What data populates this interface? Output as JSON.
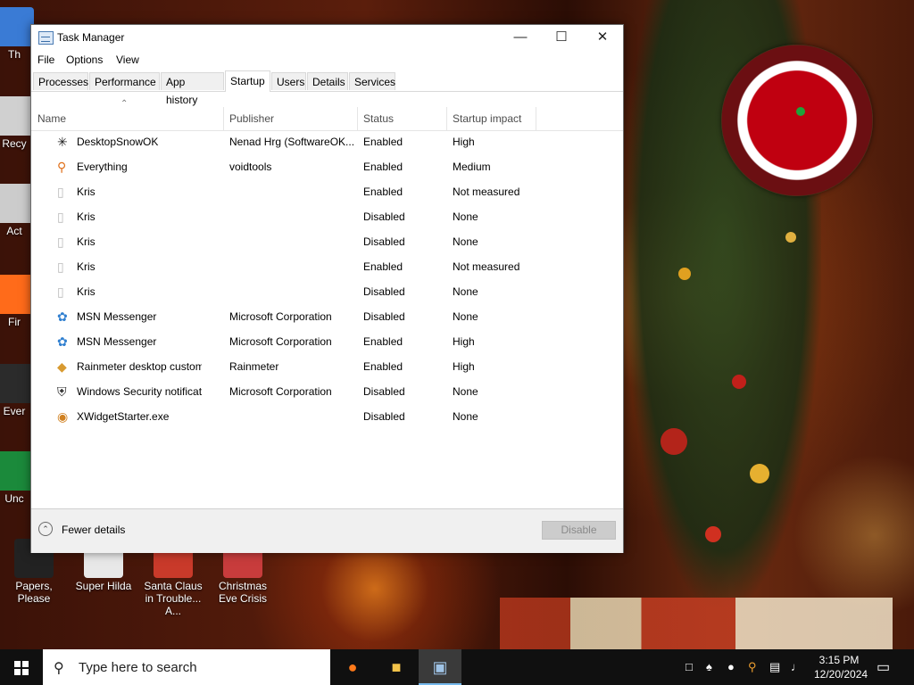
{
  "desktop": {
    "icons": [
      {
        "label": "Th",
        "color": "#3a7bd5"
      },
      {
        "label": "Recy",
        "color": "#d0d0d0"
      },
      {
        "label": "Act",
        "color": "#cccccc"
      },
      {
        "label": "Fir",
        "color": "#ff6b1a"
      },
      {
        "label": "Ever",
        "color": "#2b2b2b"
      },
      {
        "label": "Unc",
        "color": "#1b8a3b"
      },
      {
        "label": "Papers, Please",
        "color": "#222222"
      },
      {
        "label": "Super Hilda",
        "color": "#e8e8e8"
      },
      {
        "label": "Santa Claus in Trouble... A...",
        "color": "#c93a2a"
      },
      {
        "label": "Christmas Eve Crisis",
        "color": "#c83c3c"
      }
    ]
  },
  "window": {
    "title": "Task Manager",
    "controls": {
      "minimize": "—",
      "maximize": "☐",
      "close": "✕"
    },
    "menu": [
      "File",
      "Options",
      "View"
    ],
    "tabs": [
      "Processes",
      "Performance",
      "App history",
      "Startup",
      "Users",
      "Details",
      "Services"
    ],
    "active_tab": "Startup",
    "columns": {
      "name": "Name",
      "publisher": "Publisher",
      "status": "Status",
      "impact": "Startup impact"
    },
    "rows": [
      {
        "name": "DesktopSnowOK",
        "publisher": "Nenad Hrg (SoftwareOK...",
        "status": "Enabled",
        "impact": "High",
        "icon": "snowflake-icon"
      },
      {
        "name": "Everything",
        "publisher": "voidtools",
        "status": "Enabled",
        "impact": "Medium",
        "icon": "magnifier-icon"
      },
      {
        "name": "Kris",
        "publisher": "",
        "status": "Enabled",
        "impact": "Not measured",
        "icon": "blank-file-icon"
      },
      {
        "name": "Kris",
        "publisher": "",
        "status": "Disabled",
        "impact": "None",
        "icon": "blank-file-icon"
      },
      {
        "name": "Kris",
        "publisher": "",
        "status": "Disabled",
        "impact": "None",
        "icon": "blank-file-icon"
      },
      {
        "name": "Kris",
        "publisher": "",
        "status": "Enabled",
        "impact": "Not measured",
        "icon": "blank-file-icon"
      },
      {
        "name": "Kris",
        "publisher": "",
        "status": "Disabled",
        "impact": "None",
        "icon": "blank-file-icon"
      },
      {
        "name": "MSN Messenger",
        "publisher": "Microsoft Corporation",
        "status": "Disabled",
        "impact": "None",
        "icon": "msn-icon"
      },
      {
        "name": "MSN Messenger",
        "publisher": "Microsoft Corporation",
        "status": "Enabled",
        "impact": "High",
        "icon": "msn-icon"
      },
      {
        "name": "Rainmeter desktop customiz...",
        "publisher": "Rainmeter",
        "status": "Enabled",
        "impact": "High",
        "icon": "raindrop-icon"
      },
      {
        "name": "Windows Security notificati...",
        "publisher": "Microsoft Corporation",
        "status": "Disabled",
        "impact": "None",
        "icon": "shield-icon"
      },
      {
        "name": "XWidgetStarter.exe",
        "publisher": "",
        "status": "Disabled",
        "impact": "None",
        "icon": "xwidget-icon"
      }
    ],
    "footer": {
      "fewer_details": "Fewer details",
      "disable_button": "Disable"
    }
  },
  "taskbar": {
    "search_placeholder": "Type here to search",
    "apps": [
      "firefox-icon",
      "file-explorer-icon",
      "task-manager-icon"
    ],
    "tray_icons": [
      "task-view-icon",
      "network-people-icon",
      "raindrop-icon",
      "everything-tray-icon",
      "network-icon",
      "volume-muted-icon"
    ],
    "time": "3:15 PM",
    "date": "12/20/2024"
  }
}
